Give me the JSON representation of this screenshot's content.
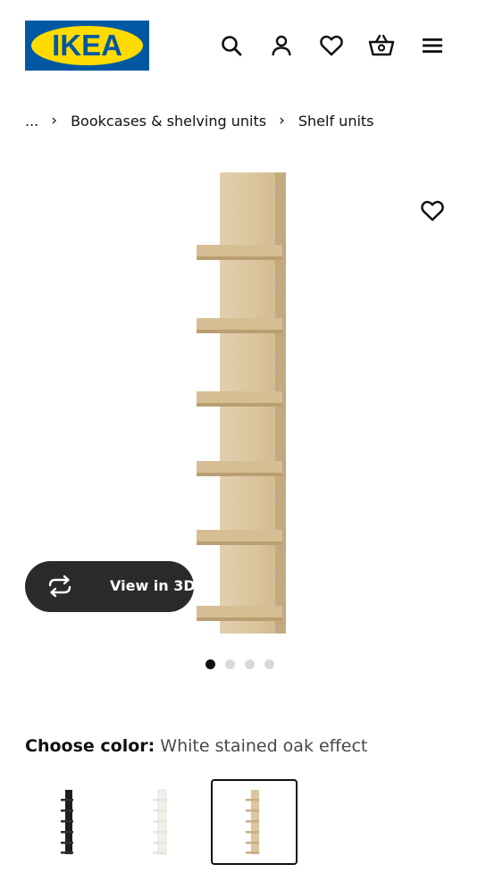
{
  "header": {
    "logo_text": "IKEA",
    "icons": [
      "search-icon",
      "account-icon",
      "heart-icon",
      "basket-icon",
      "menu-icon"
    ]
  },
  "breadcrumb": {
    "items": [
      "...",
      "Bookcases & shelving units",
      "Shelf units"
    ]
  },
  "product": {
    "view3d_label": "View in 3D",
    "image_count": 4,
    "active_image": 1
  },
  "color": {
    "label": "Choose color:",
    "selected": "White stained oak effect",
    "swatches": [
      "black-brown",
      "white",
      "white-stained-oak-effect"
    ],
    "selected_index": 2
  },
  "colors": {
    "brand_blue": "#0058a3",
    "brand_yellow": "#ffdb00",
    "dark_button": "#2a2a2a",
    "wood": "#dcc6a0"
  }
}
